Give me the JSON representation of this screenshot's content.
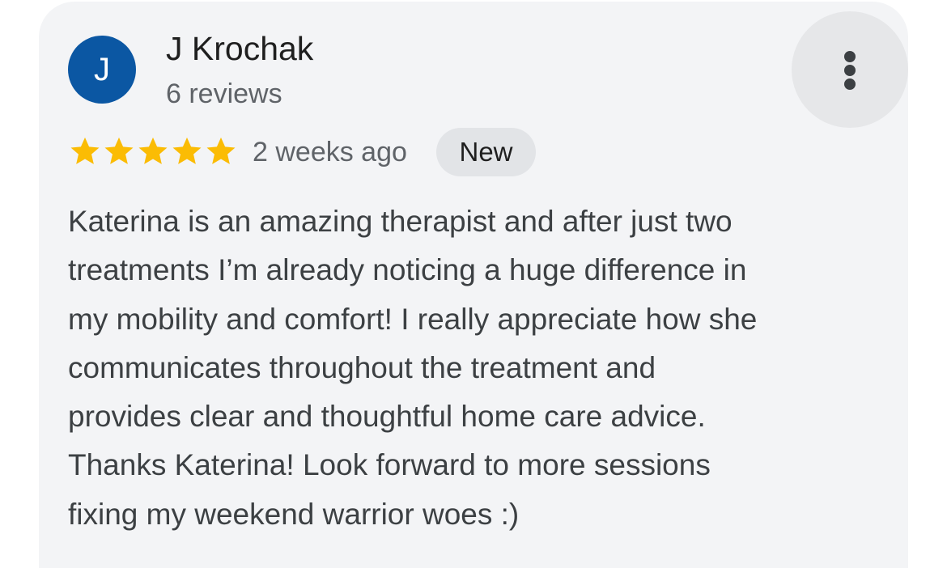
{
  "review": {
    "avatar_initial": "J",
    "reviewer_name": "J Krochak",
    "review_count": "6 reviews",
    "rating": 5,
    "rating_max": 5,
    "time_ago": "2 weeks ago",
    "badge": "New",
    "text_lines": [
      "Katerina is an amazing therapist and after just two",
      "treatments I’m already noticing a huge difference in",
      "my mobility and comfort! I really appreciate how she",
      "communicates throughout the treatment and",
      "provides clear and thoughtful home care advice.",
      "Thanks Katerina! Look forward to more sessions",
      "fixing my weekend warrior woes :)"
    ]
  },
  "icons": {
    "star": "star-icon",
    "more": "more-vert-icon"
  },
  "colors": {
    "avatar_bg": "#0b57a3",
    "star": "#fbbc04",
    "card_bg": "#f3f4f6",
    "badge_bg": "#e2e4e7"
  }
}
